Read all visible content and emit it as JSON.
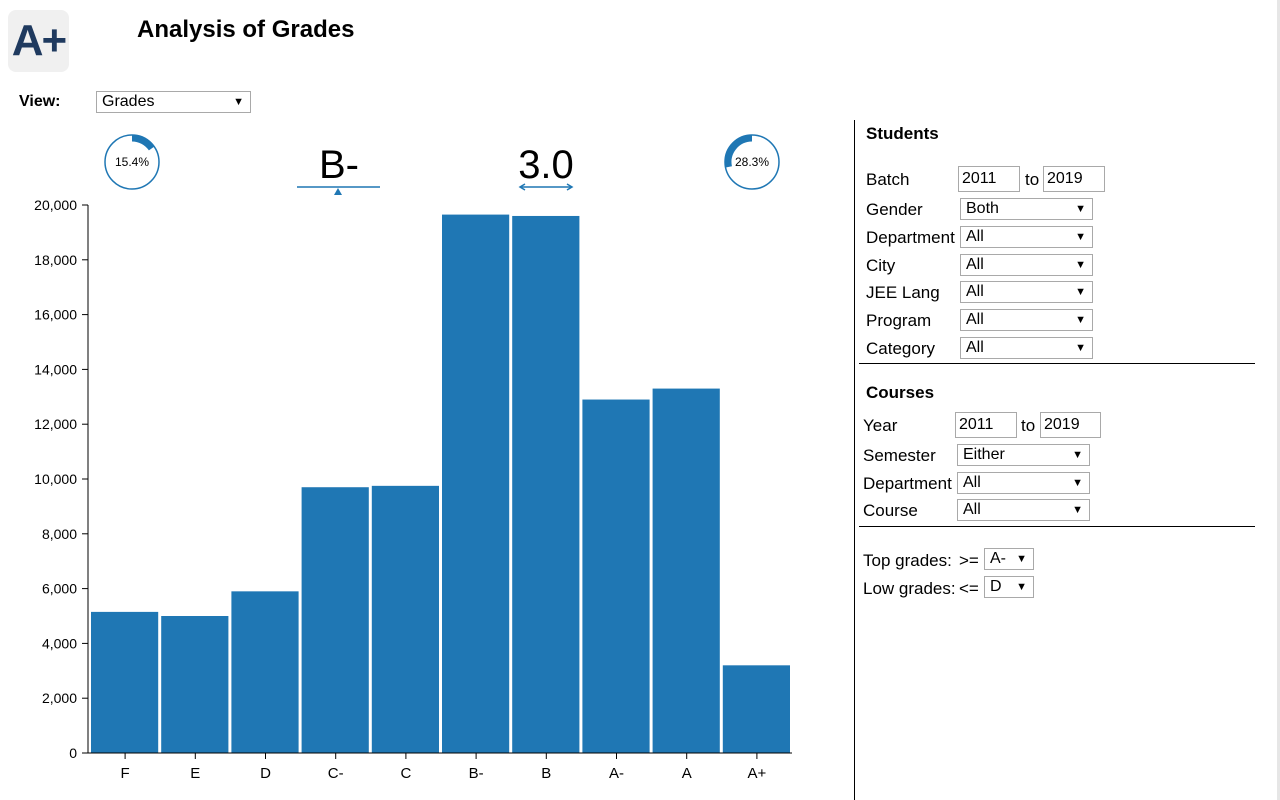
{
  "app": {
    "logo_text": "A+",
    "title": "Analysis of Grades"
  },
  "view": {
    "label": "View:",
    "value": "Grades"
  },
  "indicators": {
    "left_ring": {
      "label": "15.4%",
      "fraction": 0.154
    },
    "right_ring": {
      "label": "28.3%",
      "fraction": 0.283
    },
    "median_grade": "B-",
    "mean_gpa": "3.0"
  },
  "students": {
    "title": "Students",
    "batch": {
      "label": "Batch",
      "from": "2011",
      "to_label": "to",
      "to": "2019"
    },
    "gender": {
      "label": "Gender",
      "value": "Both"
    },
    "department": {
      "label": "Department",
      "value": "All"
    },
    "city": {
      "label": "City",
      "value": "All"
    },
    "jee_lang": {
      "label": "JEE Lang",
      "value": "All"
    },
    "program": {
      "label": "Program",
      "value": "All"
    },
    "category": {
      "label": "Category",
      "value": "All"
    }
  },
  "courses": {
    "title": "Courses",
    "year": {
      "label": "Year",
      "from": "2011",
      "to_label": "to",
      "to": "2019"
    },
    "semester": {
      "label": "Semester",
      "value": "Either"
    },
    "department": {
      "label": "Department",
      "value": "All"
    },
    "course": {
      "label": "Course",
      "value": "All"
    }
  },
  "thresholds": {
    "top": {
      "label": "Top grades:",
      "op": ">=",
      "value": "A-"
    },
    "low": {
      "label": "Low grades:",
      "op": "<=",
      "value": "D"
    }
  },
  "colors": {
    "bar": "#1f77b4",
    "accent": "#1f77b4",
    "ring_track": "#1f77b4"
  },
  "icons": {
    "dropdown": "chevron-down-icon"
  },
  "chart_data": {
    "type": "bar",
    "categories": [
      "F",
      "E",
      "D",
      "C-",
      "C",
      "B-",
      "B",
      "A-",
      "A",
      "A+"
    ],
    "values": [
      5150,
      5000,
      5900,
      9700,
      9750,
      19650,
      19600,
      12900,
      13300,
      3200
    ],
    "yticks": [
      "0",
      "2,000",
      "4,000",
      "6,000",
      "8,000",
      "10,000",
      "12,000",
      "14,000",
      "16,000",
      "18,000",
      "20,000"
    ],
    "ylim": [
      0,
      20000
    ],
    "xlabel": "",
    "ylabel": "",
    "title": ""
  }
}
